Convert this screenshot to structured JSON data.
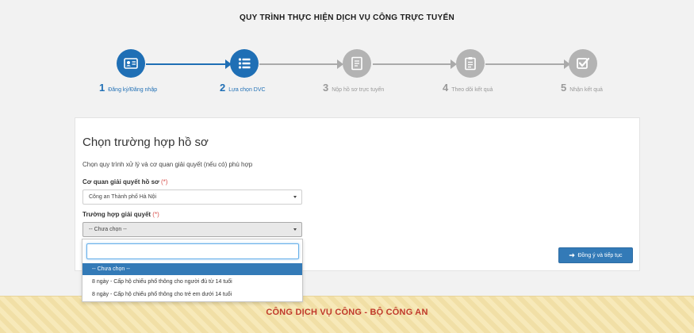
{
  "page": {
    "title": "QUY TRÌNH THỰC HIỆN DỊCH VỤ CÔNG TRỰC TUYẾN"
  },
  "steps": [
    {
      "num": "1",
      "label": "Đăng ký/Đăng nhập",
      "icon": "id-card-icon",
      "active": true
    },
    {
      "num": "2",
      "label": "Lựa chọn DVC",
      "icon": "list-icon",
      "active": true
    },
    {
      "num": "3",
      "label": "Nộp hồ sơ trực tuyến",
      "icon": "form-icon",
      "active": false
    },
    {
      "num": "4",
      "label": "Theo dõi kết quả",
      "icon": "clipboard-icon",
      "active": false
    },
    {
      "num": "5",
      "label": "Nhận kết quả",
      "icon": "checkbox-icon",
      "active": false
    }
  ],
  "form": {
    "heading": "Chọn trường hợp hồ sơ",
    "description": "Chọn quy trình xử lý và cơ quan giải quyết (nếu có) phù hợp",
    "agency": {
      "label": "Cơ quan giải quyết hồ sơ",
      "required_mark": "(*)",
      "value": "Công an Thành phố Hà Nội"
    },
    "case": {
      "label": "Trường hợp giải quyết",
      "required_mark": "(*)",
      "value": "-- Chưa chọn --",
      "search_value": "",
      "options": [
        {
          "label": "-- Chưa chọn --",
          "selected": true
        },
        {
          "label": "8 ngày - Cấp hộ chiếu phổ thông cho người đủ từ 14 tuổi",
          "selected": false
        },
        {
          "label": "8 ngày - Cấp hộ chiếu phổ thông cho trẻ em dưới 14 tuổi",
          "selected": false
        }
      ]
    },
    "submit_label": "Đồng ý và tiếp tục"
  },
  "footer": {
    "text": "CÔNG DỊCH VỤ CÔNG - BỘ CÔNG AN"
  },
  "colors": {
    "primary": "#1f6fb5",
    "button": "#337ab7",
    "inactive": "#b3b3b3",
    "footer_text": "#c0392b",
    "footer_bg": "#f5e7b5"
  }
}
